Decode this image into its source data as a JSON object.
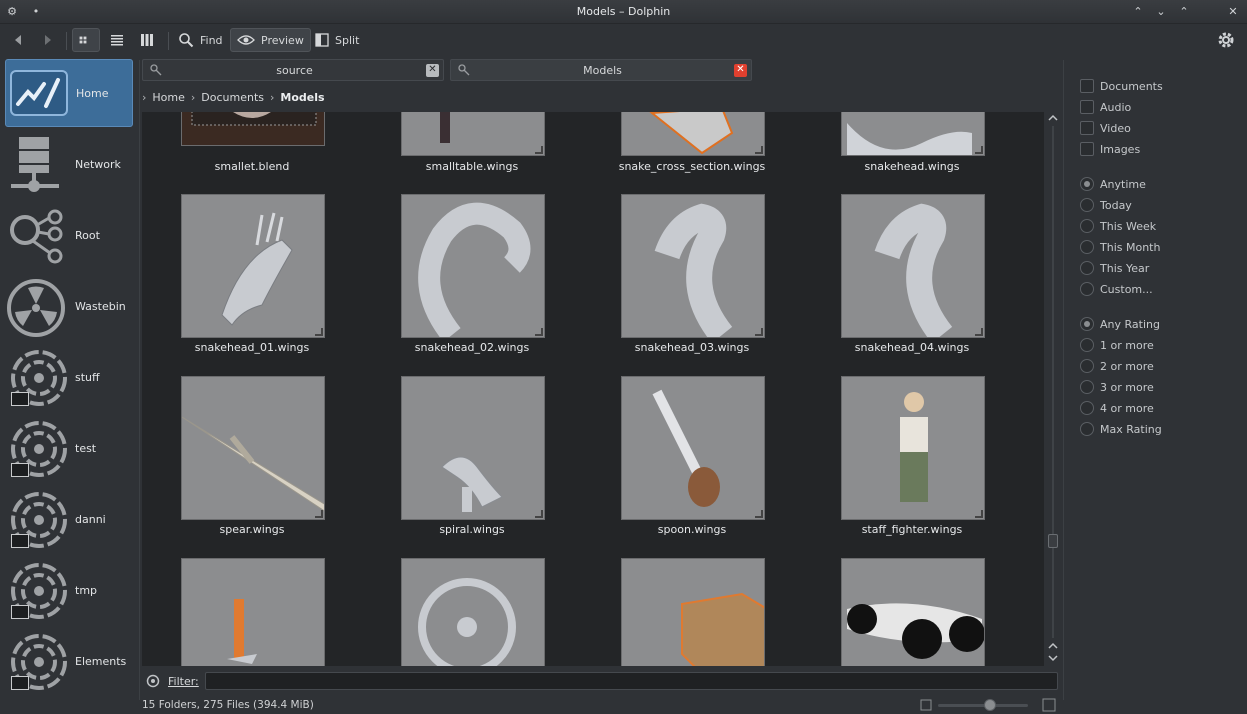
{
  "window": {
    "title": "Models – Dolphin"
  },
  "toolbar": {
    "find_label": "Find",
    "preview_label": "Preview",
    "split_label": "Split"
  },
  "places": [
    {
      "label": "Home",
      "icon": "home-icon"
    },
    {
      "label": "Network",
      "icon": "network-icon"
    },
    {
      "label": "Root",
      "icon": "root-icon"
    },
    {
      "label": "Wastebin",
      "icon": "wastebin-icon"
    },
    {
      "label": "stuff",
      "icon": "drive-icon"
    },
    {
      "label": "test",
      "icon": "drive-icon"
    },
    {
      "label": "danni",
      "icon": "drive-icon"
    },
    {
      "label": "tmp",
      "icon": "drive-icon"
    },
    {
      "label": "Elements",
      "icon": "drive-icon"
    }
  ],
  "tabs": [
    {
      "label": "source"
    },
    {
      "label": "Models"
    }
  ],
  "breadcrumb": [
    "Home",
    "Documents",
    "Models"
  ],
  "files": [
    {
      "name": "smallet.blend"
    },
    {
      "name": "smalltable.wings"
    },
    {
      "name": "snake_cross_section.wings"
    },
    {
      "name": "snakehead.wings"
    },
    {
      "name": "snakehead_01.wings"
    },
    {
      "name": "snakehead_02.wings"
    },
    {
      "name": "snakehead_03.wings"
    },
    {
      "name": "snakehead_04.wings"
    },
    {
      "name": "spear.wings"
    },
    {
      "name": "spiral.wings"
    },
    {
      "name": "spoon.wings"
    },
    {
      "name": "staff_fighter.wings"
    }
  ],
  "filter": {
    "label": "Filter:",
    "value": ""
  },
  "status": {
    "text": "15 Folders, 275 Files (394.4 MiB)"
  },
  "filter_panel": {
    "types": [
      "Documents",
      "Audio",
      "Video",
      "Images"
    ],
    "dates": [
      "Anytime",
      "Today",
      "This Week",
      "This Month",
      "This Year",
      "Custom..."
    ],
    "ratings": [
      "Any Rating",
      "1 or more",
      "2 or more",
      "3 or more",
      "4 or more",
      "Max Rating"
    ]
  },
  "colors": {
    "accent": "#3d6d99",
    "close_tab": "#e0402f"
  }
}
